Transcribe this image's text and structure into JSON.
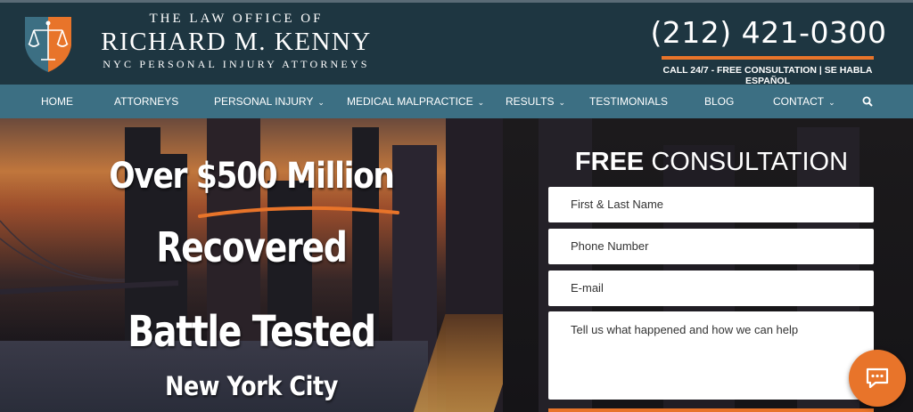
{
  "header": {
    "logo_line1": "THE LAW OFFICE OF",
    "logo_line2": "RICHARD M. KENNY",
    "logo_line3": "NYC PERSONAL INJURY ATTORNEYS",
    "phone": "(212) 421-0300",
    "call_line": "CALL 24/7 - FREE CONSULTATION | SE HABLA ESPAÑOL"
  },
  "nav": {
    "items": [
      {
        "label": "HOME",
        "dropdown": false
      },
      {
        "label": "ATTORNEYS",
        "dropdown": false
      },
      {
        "label": "PERSONAL INJURY",
        "dropdown": true
      },
      {
        "label": "MEDICAL MALPRACTICE",
        "dropdown": true
      },
      {
        "label": "RESULTS",
        "dropdown": true
      },
      {
        "label": "TESTIMONIALS",
        "dropdown": false
      },
      {
        "label": "BLOG",
        "dropdown": false
      },
      {
        "label": "CONTACT",
        "dropdown": true
      }
    ],
    "search_icon": "search-icon"
  },
  "hero": {
    "line1": "Over $500 Million",
    "line2": "Recovered",
    "line3": "Battle Tested",
    "line4": "New York City"
  },
  "form": {
    "title_bold": "FREE",
    "title_rest": " CONSULTATION",
    "name_placeholder": "First & Last Name",
    "phone_placeholder": "Phone Number",
    "email_placeholder": "E-mail",
    "message_placeholder": "Tell us what happened and how we can help"
  },
  "colors": {
    "header_bg": "#1e3641",
    "nav_bg": "#3c6f83",
    "accent": "#e8742a"
  },
  "chat": {
    "icon": "chat-icon"
  }
}
